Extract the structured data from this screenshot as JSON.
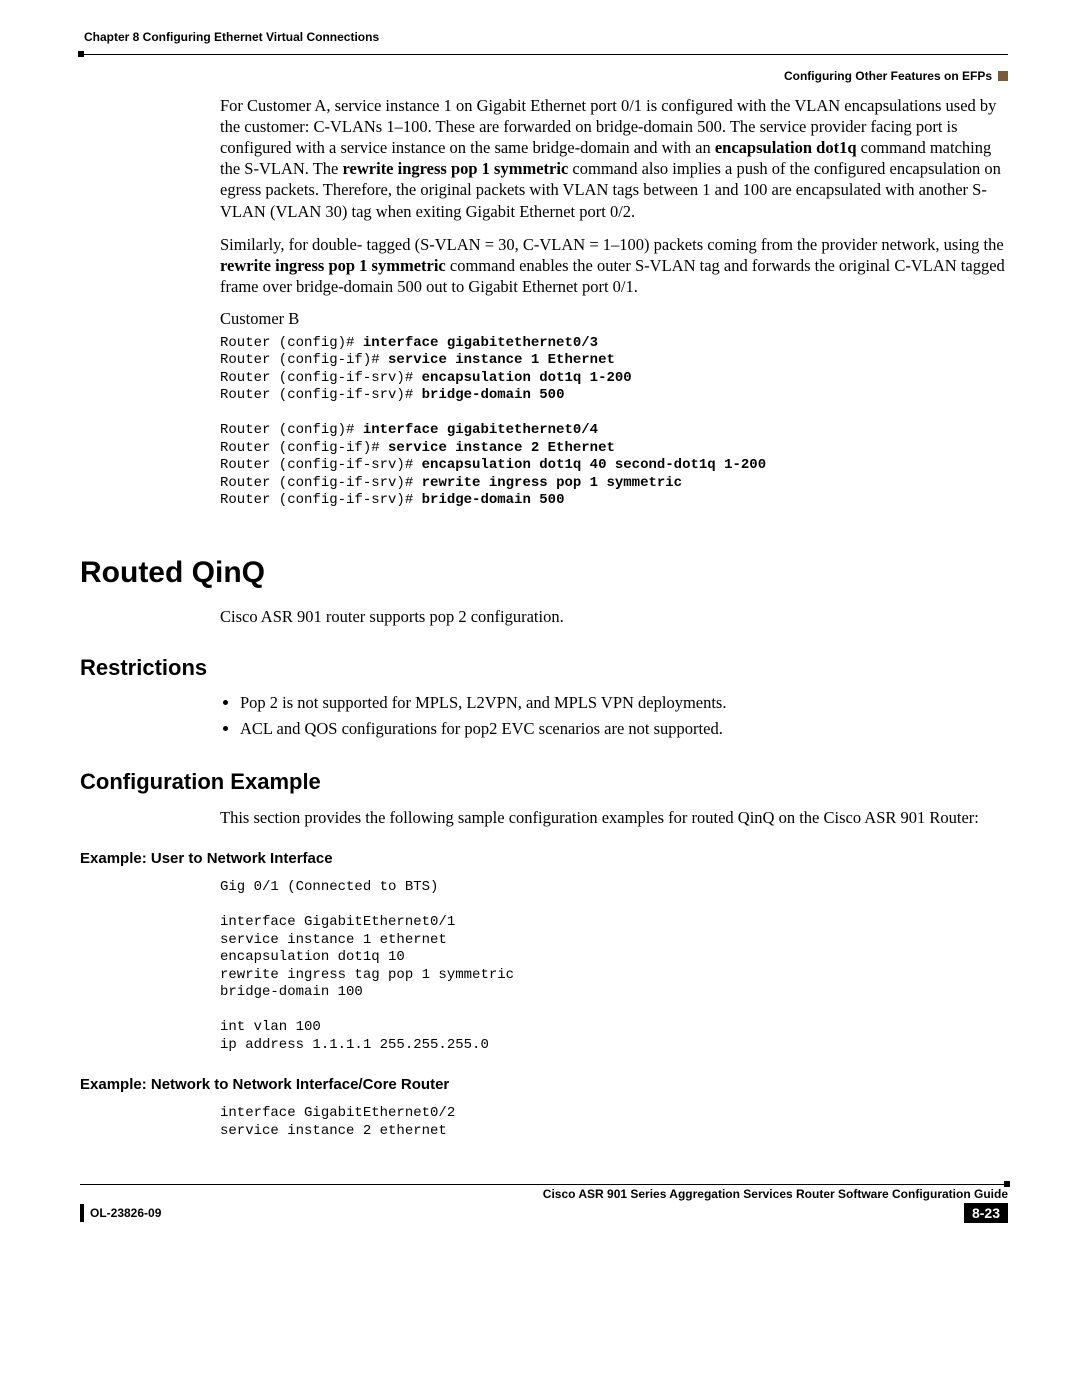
{
  "header": {
    "chapter_line": "Chapter 8    Configuring Ethernet Virtual Connections",
    "section_right": "Configuring Other Features on EFPs"
  },
  "para1_parts": {
    "p1_a": "For Customer A, service instance 1 on Gigabit Ethernet port 0/1 is configured with the VLAN encapsulations used by the customer: C-VLANs 1–100. These are forwarded on bridge-domain 500. The service provider facing port is configured with a service instance on the same bridge-domain and with an ",
    "p1_b": "encapsulation dot1q",
    "p1_c": " command matching the S-VLAN. The ",
    "p1_d": "rewrite ingress pop 1 symmetric",
    "p1_e": " command also implies a push of the configured encapsulation on egress packets. Therefore, the original packets with VLAN tags between 1 and 100 are encapsulated with another S-VLAN (VLAN 30) tag when exiting Gigabit Ethernet port 0/2."
  },
  "para2_parts": {
    "p2_a": "Similarly, for double- tagged (S-VLAN = 30, C-VLAN = 1–100) packets coming from the provider network, using the ",
    "p2_b": "rewrite ingress pop 1 symmetric",
    "p2_c": " command enables the outer S-VLAN tag and forwards the original C-VLAN tagged frame over bridge-domain 500 out to Gigabit Ethernet port 0/1."
  },
  "customer_b_label": "Customer B",
  "code1": {
    "l1p": "Router (config)# ",
    "l1b": "interface gigabitethernet0/3",
    "l2p": "Router (config-if)# ",
    "l2b": "service instance 1 Ethernet",
    "l3p": "Router (config-if-srv)# ",
    "l3b": "encapsulation dot1q 1-200",
    "l4p": "Router (config-if-srv)# ",
    "l4b": "bridge-domain 500",
    "l5": "",
    "l6p": "Router (config)# ",
    "l6b": "interface gigabitethernet0/4",
    "l7p": "Router (config-if)# ",
    "l7b": "service instance 2 Ethernet",
    "l8p": "Router (config-if-srv)# ",
    "l8b": "encapsulation dot1q 40 second-dot1q 1-200",
    "l9p": "Router (config-if-srv)# ",
    "l9b": "rewrite ingress pop 1 symmetric",
    "l10p": "Router (config-if-srv)# ",
    "l10b": "bridge-domain 500"
  },
  "h1_routed": "Routed QinQ",
  "routed_para": "Cisco ASR 901 router supports pop 2 configuration.",
  "h2_restrictions": "Restrictions",
  "restrictions": {
    "b1": "Pop 2 is not supported for MPLS, L2VPN, and MPLS VPN deployments.",
    "b2": "ACL and QOS configurations for pop2 EVC scenarios are not supported."
  },
  "h2_config_example": "Configuration Example",
  "config_example_para": "This section provides the following sample configuration examples for routed QinQ on the Cisco ASR 901 Router:",
  "h3_example_uni": "Example: User to Network Interface",
  "code_uni": "Gig 0/1 (Connected to BTS)\n\ninterface GigabitEthernet0/1\nservice instance 1 ethernet\nencapsulation dot1q 10\nrewrite ingress tag pop 1 symmetric\nbridge-domain 100\n\nint vlan 100\nip address 1.1.1.1 255.255.255.0",
  "h3_example_nni": "Example: Network to Network Interface/Core Router",
  "code_nni": "interface GigabitEthernet0/2\nservice instance 2 ethernet",
  "footer": {
    "guide_title": "Cisco ASR 901 Series Aggregation Services Router Software Configuration Guide",
    "doc_id": "OL-23826-09",
    "page_num": "8-23"
  }
}
